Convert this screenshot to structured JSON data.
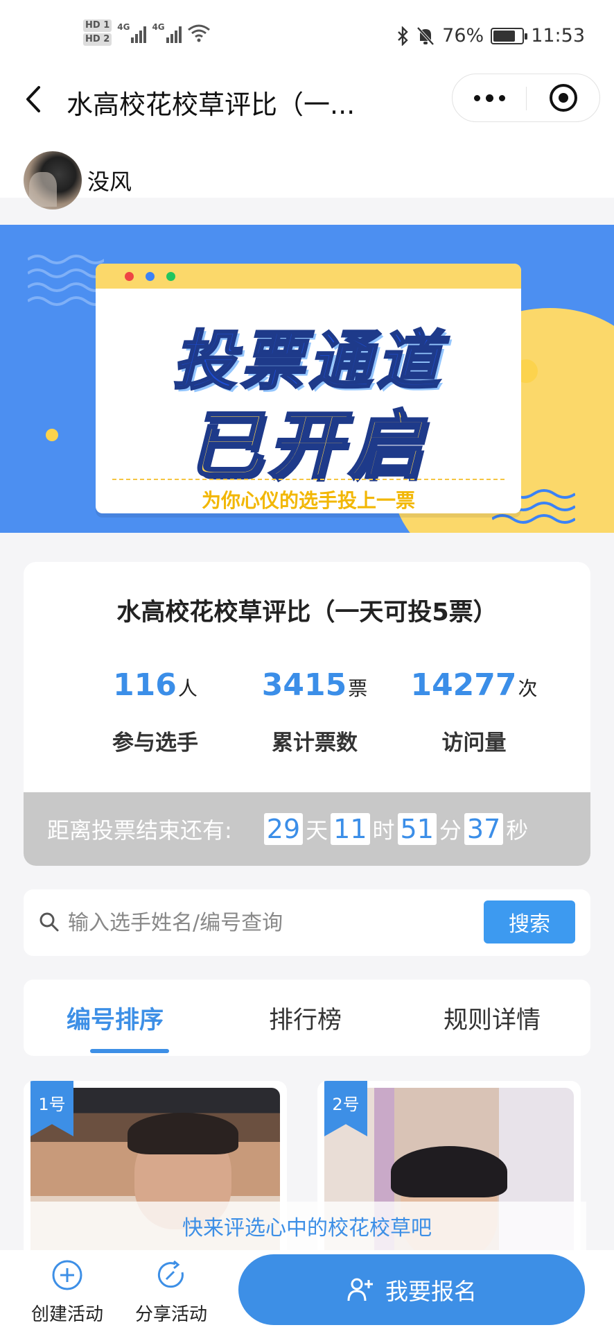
{
  "status_bar": {
    "hd1": "HD 1",
    "hd2": "HD 2",
    "sig1": "4G",
    "sig2": "4G",
    "battery": "76%",
    "time": "11:53"
  },
  "nav": {
    "title": "水高校花校草评比（一...",
    "more_icon": "more-dots-icon",
    "close_icon": "target-close-icon"
  },
  "author": {
    "name": "没风"
  },
  "banner": {
    "line1": "投票通道",
    "line2": "已开启",
    "subtitle": "为你心仪的选手投上一票",
    "colors": {
      "bg": "#4c8ff1",
      "yellow": "#fcd34d",
      "navy": "#1e3a8a"
    }
  },
  "stats": {
    "title": "水高校花校草评比（一天可投5票）",
    "items": [
      {
        "num": "116",
        "unit": "人",
        "label": "参与选手"
      },
      {
        "num": "3415",
        "unit": "票",
        "label": "累计票数"
      },
      {
        "num": "14277",
        "unit": "次",
        "label": "访问量"
      }
    ],
    "countdown": {
      "label": "距离投票结束还有:",
      "days": "29",
      "days_unit": "天",
      "hours": "11",
      "hours_unit": "时",
      "minutes": "51",
      "minutes_unit": "分",
      "seconds": "37",
      "seconds_unit": "秒"
    }
  },
  "search": {
    "placeholder": "输入选手姓名/编号查询",
    "button": "搜索"
  },
  "tabs": [
    {
      "label": "编号排序",
      "active": true
    },
    {
      "label": "排行榜",
      "active": false
    },
    {
      "label": "规则详情",
      "active": false
    }
  ],
  "contestants": [
    {
      "badge": "1号"
    },
    {
      "badge": "2号"
    }
  ],
  "marquee": "快来评选心中的校花校草吧",
  "bottom_bar": {
    "create": "创建活动",
    "share": "分享活动",
    "signup": "我要报名"
  },
  "accent_color": "#3d8fe6"
}
